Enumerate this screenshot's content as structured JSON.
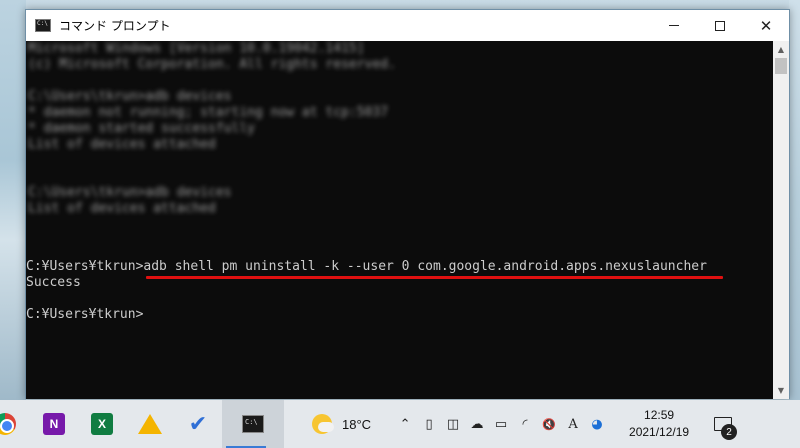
{
  "window": {
    "title": "コマンド プロンプト",
    "controls": {
      "minimize": "minimize",
      "maximize": "maximize",
      "close": "✕"
    }
  },
  "console": {
    "blurred_lines": [
      "Microsoft Windows [Version 10.0.19042.1415]",
      "(c) Microsoft Corporation. All rights reserved.",
      "",
      "C:\\Users\\tkrun>adb devices",
      "* daemon not running; starting now at tcp:5037",
      "* daemon started successfully",
      "List of devices attached",
      "",
      "",
      "C:\\Users\\tkrun>adb devices",
      "List of devices attached"
    ],
    "prompt1": "C:¥Users¥tkrun>",
    "command": "adb shell pm uninstall -k --user 0 com.google.android.apps.nexuslauncher",
    "result": "Success",
    "prompt2": "C:¥Users¥tkrun>",
    "highlight_color": "#e01010"
  },
  "taskbar": {
    "apps": [
      {
        "name": "chrome-icon"
      },
      {
        "name": "onenote-icon",
        "label": "N",
        "color": "#7719aa"
      },
      {
        "name": "excel-icon",
        "label": "X",
        "color": "#107c41"
      },
      {
        "name": "google-drive-icon"
      },
      {
        "name": "todo-icon",
        "label": "✔"
      },
      {
        "name": "command-prompt-icon"
      }
    ],
    "weather": {
      "temperature": "18°C",
      "icon": "partly-sunny-icon"
    },
    "tray_icons": [
      "chevron-up-icon",
      "usb-icon",
      "meet-now-icon",
      "onedrive-icon",
      "battery-icon",
      "wifi-icon",
      "volume-mute-icon",
      "ime-icon",
      "edge-icon"
    ],
    "tray_glyphs": {
      "chevron": "⌃",
      "usb": "▯",
      "meet": "◫",
      "cloud": "☁",
      "battery": "▭",
      "wifi": "◜",
      "volume": "🔇",
      "ime": "A",
      "edge": "◕"
    },
    "clock": {
      "time": "12:59",
      "date": "2021/12/19"
    },
    "notifications": {
      "count": "2"
    }
  }
}
